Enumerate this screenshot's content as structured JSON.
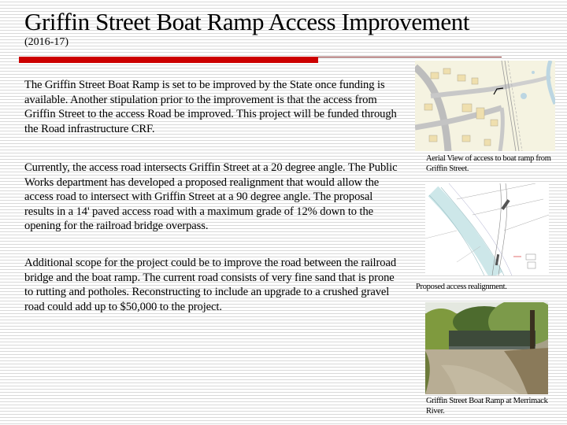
{
  "slide": {
    "title": "Griffin Street Boat Ramp Access Improvement",
    "subtitle": "(2016-17)",
    "accent_color": "#cc0000",
    "rule_color": "#7a1f1f"
  },
  "body": {
    "paragraphs": [
      "The Griffin Street Boat Ramp is set to be improved by the State once funding is available.  Another stipulation prior to the improvement is that the access from Griffin Street to the access Road be improved.  This project will be funded through the Road infrastructure CRF.",
      "Currently, the access road intersects Griffin Street at a 20 degree angle.  The Public Works department has developed a proposed realignment that would allow the access road to intersect with Griffin Street at a 90 degree angle.  The proposal results in a 14' paved access road with a maximum grade of 12% down to the opening for the railroad bridge overpass.",
      "Additional scope for the project could be to improve the road between the railroad bridge and the boat ramp.  The current road consists of very fine sand that is prone to rutting and potholes.  Reconstructing to include an upgrade to a crushed gravel road could add up to $50,000 to the project."
    ]
  },
  "figures": [
    {
      "kind": "aerial-map",
      "caption": "Aerial View of access to boat ramp from Griffin Street."
    },
    {
      "kind": "engineering-drawing",
      "caption": "Proposed access realignment."
    },
    {
      "kind": "photo",
      "caption": "Griffin Street Boat Ramp at Merrimack River."
    }
  ]
}
